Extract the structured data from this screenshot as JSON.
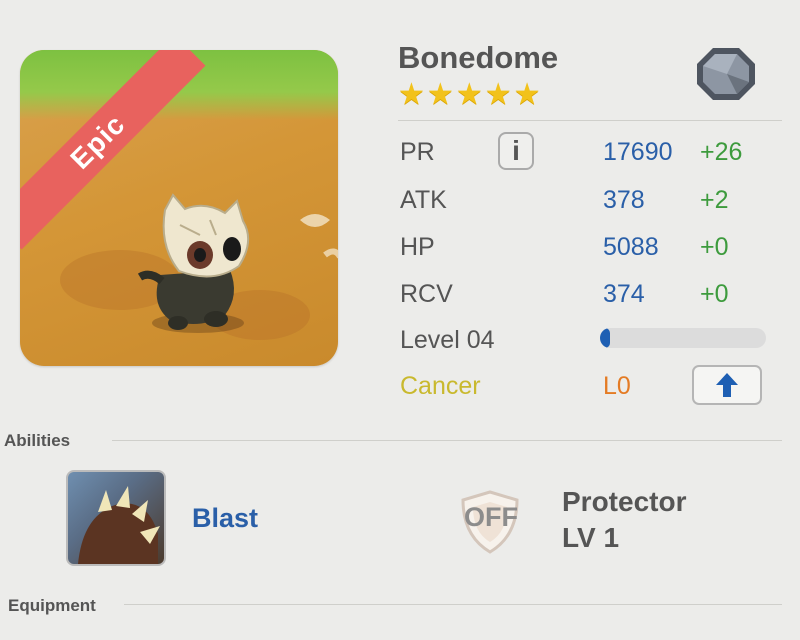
{
  "monster": {
    "name": "Bonedome",
    "rarity": "Epic",
    "stars": 5,
    "zodiac_symbol": "♋",
    "element_icon": "stone-gem-icon"
  },
  "stats": {
    "pr": {
      "label": "PR",
      "value": "17690",
      "bonus": "+26"
    },
    "atk": {
      "label": "ATK",
      "value": "378",
      "bonus": "+2"
    },
    "hp": {
      "label": "HP",
      "value": "5088",
      "bonus": "+0"
    },
    "rcv": {
      "label": "RCV",
      "value": "374",
      "bonus": "+0"
    },
    "info_label": "i"
  },
  "level": {
    "label": "Level 04",
    "progress": 0.06
  },
  "zodiac": {
    "name": "Cancer",
    "level": "L0"
  },
  "sections": {
    "abilities": "Abilities",
    "equipment": "Equipment"
  },
  "abilities": {
    "active_name": "Blast",
    "passive_status": "OFF",
    "passive_name": "Protector",
    "passive_level": "LV 1"
  },
  "colors": {
    "value_blue": "#2a5fa8",
    "bonus_green": "#3d9b3d",
    "epic_red": "#e8625e",
    "star_gold": "#f2c21b",
    "zodiac_yellow": "#c9b92e",
    "zodiac_level_orange": "#e47b24"
  }
}
